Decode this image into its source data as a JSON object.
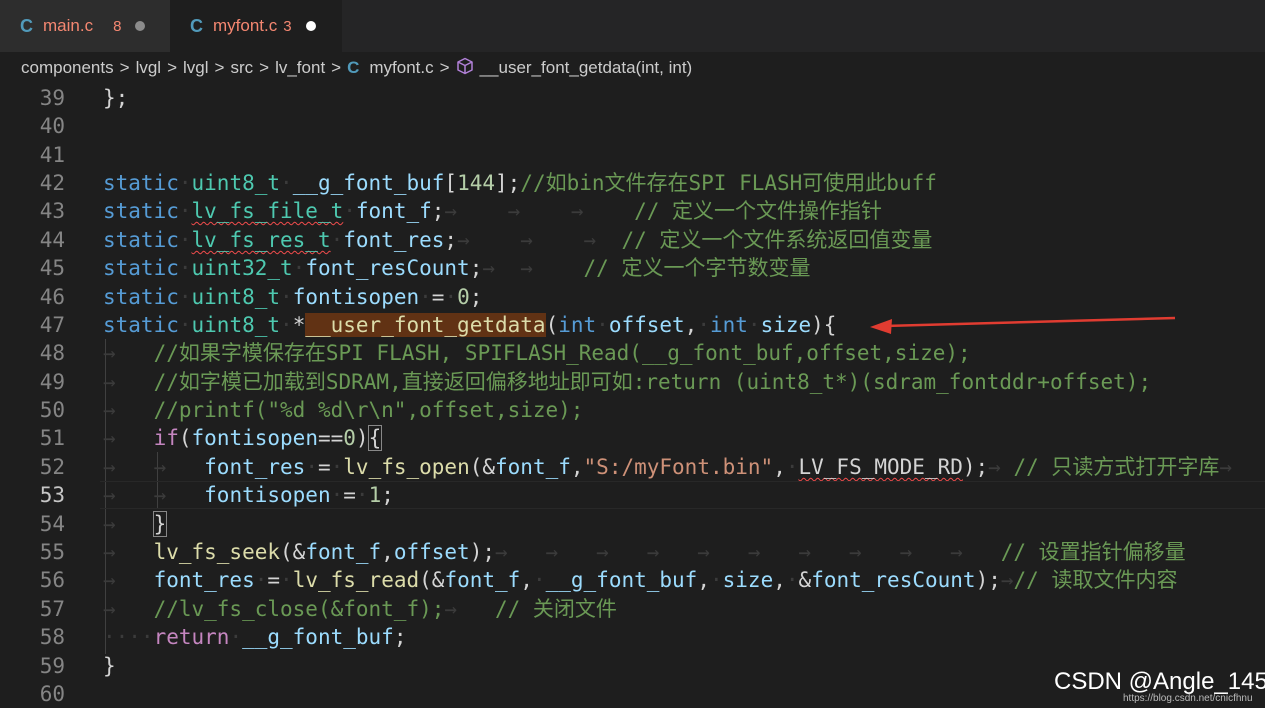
{
  "tabs": [
    {
      "icon": "C",
      "name": "main.c",
      "count": "8"
    },
    {
      "icon": "C",
      "name": "myfont.c",
      "count": "3"
    }
  ],
  "breadcrumb": {
    "items": [
      "components",
      "lvgl",
      "lvgl",
      "src",
      "lv_font"
    ],
    "file_icon": "C",
    "file": "myfont.c",
    "symbol": "__user_font_getdata(int, int)"
  },
  "lines": {
    "n39": "39",
    "n40": "40",
    "n41": "41",
    "n42": "42",
    "n43": "43",
    "n44": "44",
    "n45": "45",
    "n46": "46",
    "n47": "47",
    "n48": "48",
    "n49": "49",
    "n50": "50",
    "n51": "51",
    "n52": "52",
    "n53": "53",
    "n54": "54",
    "n55": "55",
    "n56": "56",
    "n57": "57",
    "n58": "58",
    "n59": "59",
    "n60": "60"
  },
  "code": {
    "l39": "};",
    "static": "static",
    "uint8_t": "uint8_t",
    "uint32_t": "uint32_t",
    "l42_var": "__g_font_buf",
    "l42_num": "144",
    "l42_cm": "//如bin文件存在SPI FLASH可使用此buff",
    "l43_ty": "lv_fs_file_t",
    "l43_var": "font_f",
    "l43_cm": "// 定义一个文件操作指针",
    "l44_ty": "lv_fs_res_t",
    "l44_var": "font_res",
    "l44_cm": "// 定义一个文件系统返回值变量",
    "l45_var": "font_resCount",
    "l45_cm": "// 定义一个字节数变量",
    "l46_var": "fontisopen",
    "l46_num": "0",
    "l47_fn": "__user_font_getdata",
    "int": "int",
    "offset": "offset",
    "size": "size",
    "l48_cm": "//如果字模保存在SPI FLASH, SPIFLASH_Read(__g_font_buf,offset,size);",
    "l49_cm": "//如字模已加载到SDRAM,直接返回偏移地址即可如:return (uint8_t*)(sdram_fontddr+offset);",
    "l50_cm": "//printf(\"%d %d\\r\\n\",offset,size);",
    "if": "if",
    "l51_num": "0",
    "font_res": "font_res",
    "lv_fs_open": "lv_fs_open",
    "font_f": "font_f",
    "l52_str": "\"S:/myFont.bin\"",
    "l52_mode": "LV_FS_MODE_RD",
    "l52_cm": "// 只读方式打开字库",
    "fontisopen": "fontisopen",
    "l53_num": "1",
    "lv_fs_seek": "lv_fs_seek",
    "l55_cm": "// 设置指针偏移量",
    "lv_fs_read": "lv_fs_read",
    "g_font_buf": "__g_font_buf",
    "font_resCount": "font_resCount",
    "l56_cm": "// 读取文件内容",
    "l57_cm": "//lv_fs_close(&font_f);",
    "l57_cm2": "// 关闭文件",
    "return": "return",
    "l59": "}"
  },
  "watermark": {
    "text": "CSDN @Angle_145",
    "url": "https://blog.csdn.net/cnicfhnu"
  },
  "colors": {
    "tab_error": "#f48771",
    "c_icon": "#519aba",
    "highlight": "#613214",
    "arrow": "#e03c31"
  }
}
